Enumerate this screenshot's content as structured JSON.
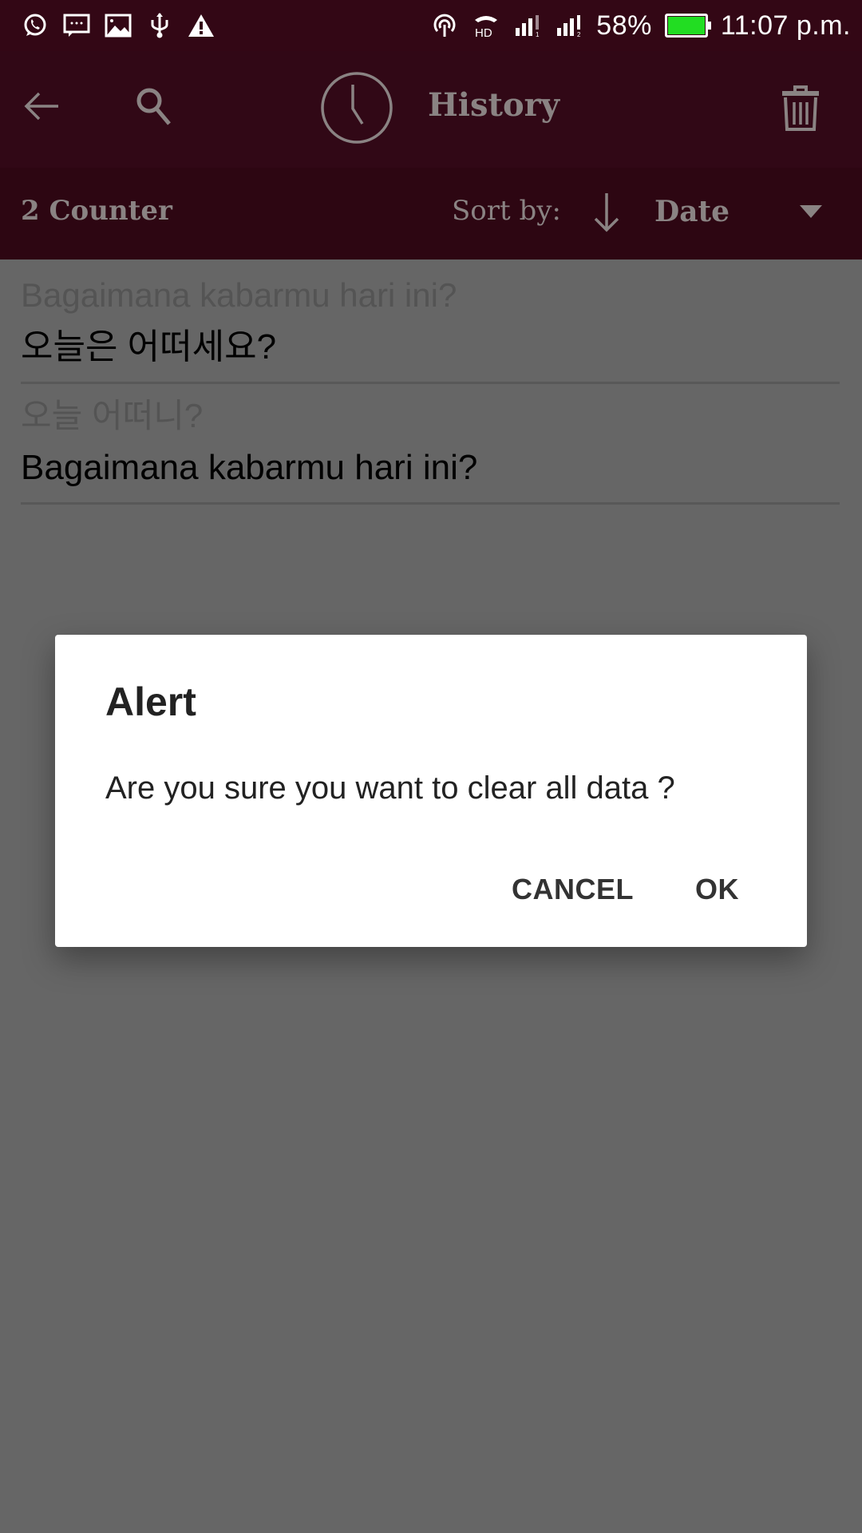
{
  "status_bar": {
    "left_icons": [
      "whatsapp-icon",
      "message-icon",
      "image-icon",
      "usb-icon",
      "warning-icon"
    ],
    "right_icons": [
      "hotspot-icon",
      "hd-call-icon",
      "signal-sim1-icon",
      "signal-sim2-icon"
    ],
    "battery_percent": "58%",
    "battery_level": 1.0,
    "battery_color": "#22dd22",
    "time": "11:07 p.m."
  },
  "toolbar": {
    "back_icon": "arrow-left-icon",
    "search_icon": "search-icon",
    "title_icon": "clock-icon",
    "title": "History",
    "delete_icon": "trash-icon",
    "background_color": "#310816"
  },
  "subbar": {
    "counter": "2 Counter",
    "sort_label": "Sort by:",
    "sort_direction_icon": "arrow-down-icon",
    "sort_value": "Date",
    "dropdown_icon": "caret-down-icon"
  },
  "history": [
    {
      "source": "Bagaimana kabarmu hari ini?",
      "translation": "오늘은 어떠세요?"
    },
    {
      "source": "오늘 어떠니?",
      "translation": "Bagaimana kabarmu hari ini?"
    }
  ],
  "dialog": {
    "title": "Alert",
    "message": "Are you sure you want to clear all data ?",
    "cancel_label": "CANCEL",
    "ok_label": "OK"
  }
}
